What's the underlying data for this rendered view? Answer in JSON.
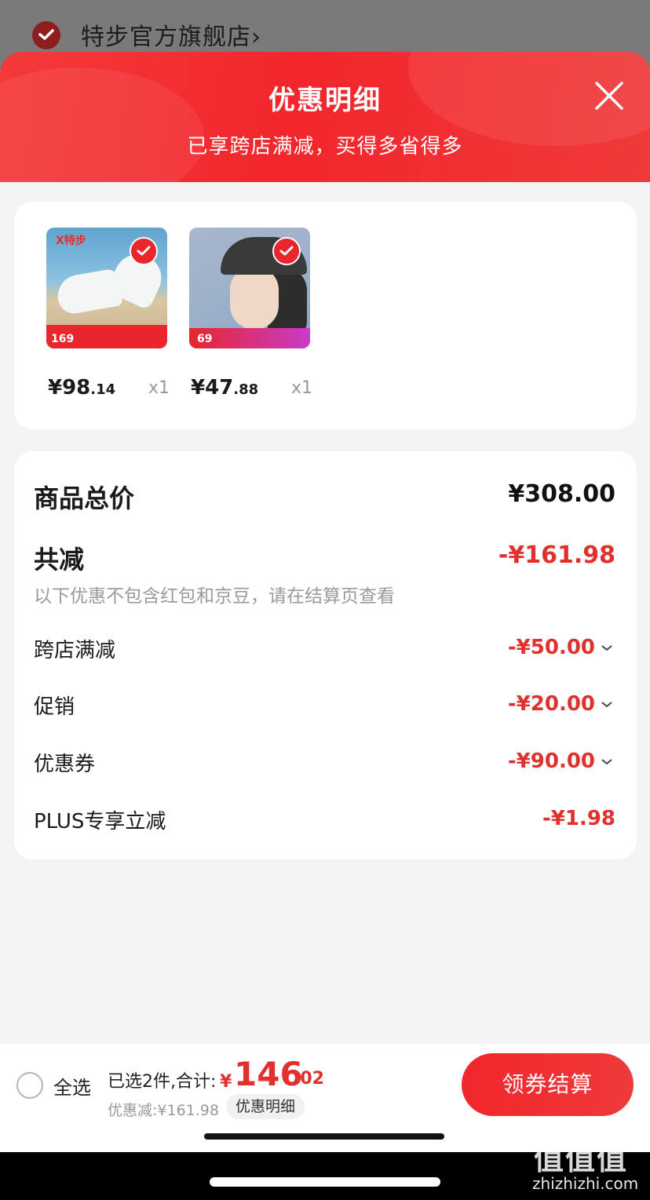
{
  "store": {
    "name": "特步官方旗舰店",
    "arrow": "›"
  },
  "sheet": {
    "title": "优惠明细",
    "subtitle": "已享跨店满减，买得多省得多",
    "close_icon": "close-icon"
  },
  "products": [
    {
      "price_int": "¥98",
      "price_dec": ".14",
      "qty": "x1",
      "checked": true,
      "img_logo": "X特步",
      "img_strip_price": "169"
    },
    {
      "price_int": "¥47",
      "price_dec": ".88",
      "qty": "x1",
      "checked": true,
      "img_strip_price": "69"
    }
  ],
  "summary": {
    "total_label": "商品总价",
    "total_value": "¥308.00",
    "reduce_label": "共减",
    "reduce_value": "-¥161.98",
    "note": "以下优惠不包含红包和京豆，请在结算页查看",
    "items": [
      {
        "label": "跨店满减",
        "value": "-¥50.00",
        "expandable": true
      },
      {
        "label": "促销",
        "value": "-¥20.00",
        "expandable": true
      },
      {
        "label": "优惠券",
        "value": "-¥90.00",
        "expandable": true
      },
      {
        "label": "PLUS专享立减",
        "value": "-¥1.98",
        "expandable": false
      }
    ]
  },
  "bottom": {
    "select_all": "全选",
    "selected_text": "已选2件,合计:",
    "total_currency": "¥",
    "total_int": "146",
    "total_dec": ".02",
    "discount_text": "优惠减:¥161.98",
    "detail_button": "优惠明细",
    "checkout_button": "领券结算"
  },
  "watermark": {
    "mark": "值值值",
    "text": "zhizhizhi.com"
  },
  "colors": {
    "accent": "#e8262c",
    "price_red": "#e0312e"
  }
}
